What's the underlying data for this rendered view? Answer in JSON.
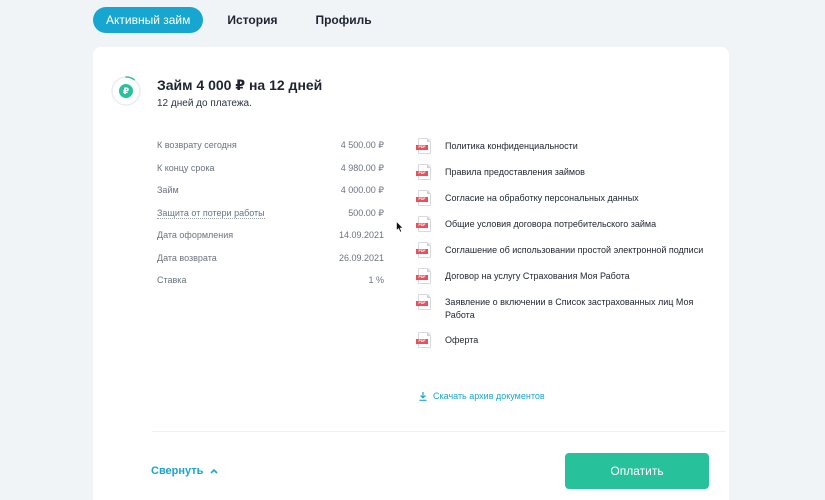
{
  "tabs": [
    {
      "label": "Активный займ",
      "active": true
    },
    {
      "label": "История",
      "active": false
    },
    {
      "label": "Профиль",
      "active": false
    }
  ],
  "loan": {
    "title": "Займ 4 000 ₽ на 12 дней",
    "subtitle": "12 дней до платежа.",
    "status_icon": "ruble-icon",
    "progress_fraction": 0.1
  },
  "details": [
    {
      "label": "К возврату сегодня",
      "value": "4 500.00 ₽"
    },
    {
      "label": "К концу срока",
      "value": "4 980.00 ₽"
    },
    {
      "label": "Займ",
      "value": "4 000.00 ₽"
    },
    {
      "label": "Защита от потери работы",
      "value": "500.00 ₽"
    },
    {
      "label": "Дата оформления",
      "value": "14.09.2021"
    },
    {
      "label": "Дата возврата",
      "value": "26.09.2021"
    },
    {
      "label": "Ставка",
      "value": "1 %"
    }
  ],
  "documents": [
    {
      "name": "Политика конфиденциальности"
    },
    {
      "name": "Правила предоставления займов"
    },
    {
      "name": "Согласие на обработку персональных данных"
    },
    {
      "name": "Общие условия договора потребительского займа"
    },
    {
      "name": "Соглашение об использовании простой электронной подписи"
    },
    {
      "name": "Договор на услугу Страхования Моя Работа"
    },
    {
      "name": "Заявление о включении в Список застрахованных лиц Моя Работа"
    },
    {
      "name": "Оферта"
    }
  ],
  "pdf_tag": "PDF",
  "download_label": "Скачать архив документов",
  "collapse_label": "Свернуть",
  "pay_label": "Оплатить",
  "colors": {
    "accent": "#17a6cf",
    "pay_button": "#27c29b",
    "progress": "#2fc39d",
    "pdf_tag": "#e8505b"
  }
}
